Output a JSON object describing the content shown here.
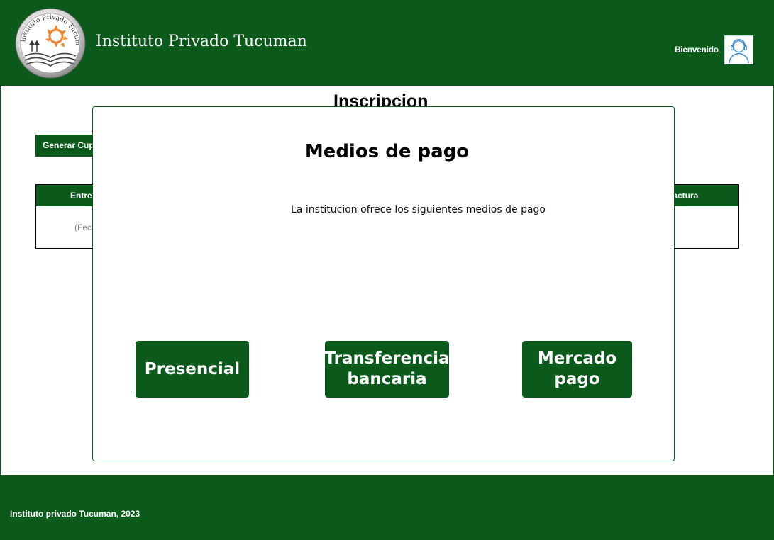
{
  "header": {
    "logo_text": "Instituto Privado Tucuman",
    "title": "Instituto Privado Tucuman",
    "welcome": "Bienvenido",
    "avatar_icon": "user-avatar-icon"
  },
  "page": {
    "heading": "Inscripcion",
    "generate_button": "Generar Cupo",
    "table": {
      "header_left": "Entrevista",
      "header_right": "Factura",
      "cell_hint": "(Fecha)"
    }
  },
  "modal": {
    "title": "Medios de pago",
    "description": "La institucion ofrece los siguientes medios de pago",
    "options": [
      {
        "lines": [
          "Presencial"
        ]
      },
      {
        "lines": [
          "Transferencia",
          "bancaria"
        ]
      },
      {
        "lines": [
          "Mercado",
          "pago"
        ]
      }
    ]
  },
  "footer": {
    "text": "Instituto privado Tucuman, 2023"
  },
  "colors": {
    "brand_green": "#0b5a1b",
    "logo_sun": "#f0842a"
  }
}
